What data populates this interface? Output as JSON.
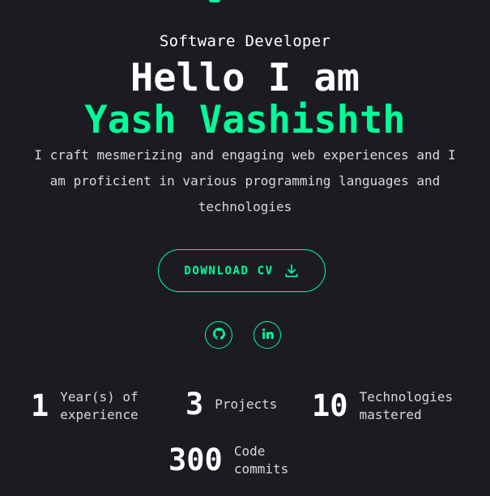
{
  "hero": {
    "role": "Software Developer",
    "greeting": "Hello I am",
    "name": "Yash Vashishth",
    "intro": "I craft mesmerizing and engaging web experiences and I am proficient in various programming languages and technologies"
  },
  "cv_button": {
    "label": "DOWNLOAD CV",
    "icon": "download-icon"
  },
  "social_links": [
    {
      "icon": "github-icon"
    },
    {
      "icon": "linkedin-icon"
    }
  ],
  "stats": [
    {
      "value": "1",
      "label": "Year(s) of experience"
    },
    {
      "value": "3",
      "label": "Projects"
    },
    {
      "value": "10",
      "label": "Technologies mastered"
    },
    {
      "value": "300",
      "label": "Code commits"
    }
  ],
  "colors": {
    "background": "#1c1b22",
    "accent": "#00ff99",
    "text": "#ffffff",
    "muted_text": "#d8d8dc"
  }
}
